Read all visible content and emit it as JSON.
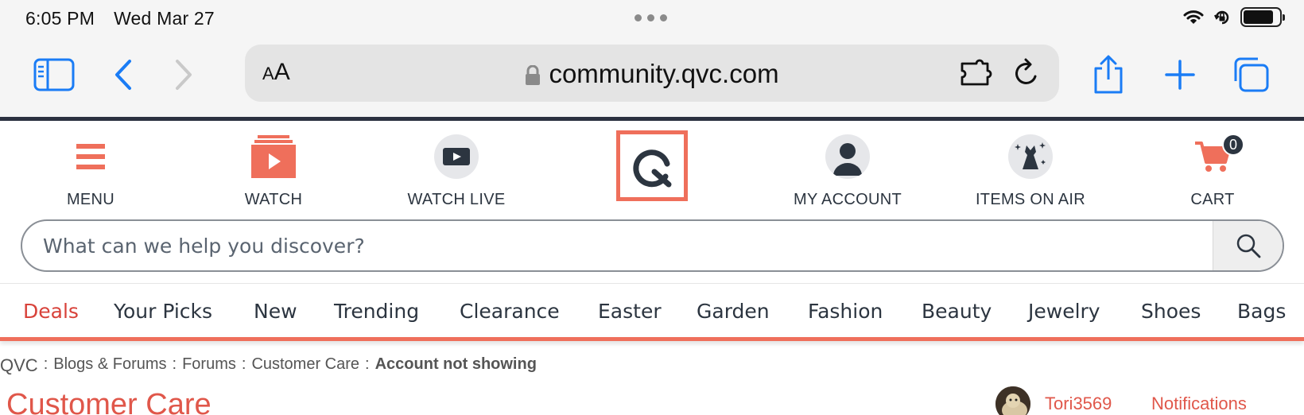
{
  "status_bar": {
    "time": "6:05 PM",
    "date": "Wed Mar 27"
  },
  "browser": {
    "font_size_label_small": "A",
    "font_size_label_large": "A",
    "url": "community.qvc.com"
  },
  "header": {
    "nav": [
      {
        "label": "MENU",
        "icon": "hamburger-icon"
      },
      {
        "label": "WATCH",
        "icon": "play-stack-icon"
      },
      {
        "label": "WATCH LIVE",
        "icon": "live-tv-icon"
      },
      {
        "label": "MY ACCOUNT",
        "icon": "user-icon"
      },
      {
        "label": "ITEMS ON AIR",
        "icon": "dress-sparkle-icon"
      },
      {
        "label": "CART",
        "icon": "cart-icon",
        "badge": "0"
      }
    ],
    "logo_icon": "qvc-logo-icon",
    "accent_color": "#ef6f5b"
  },
  "search": {
    "placeholder": "What can we help you discover?"
  },
  "categories": [
    "Deals",
    "Your Picks",
    "New",
    "Trending",
    "Clearance",
    "Easter",
    "Garden",
    "Fashion",
    "Beauty",
    "Jewelry",
    "Shoes",
    "Bags"
  ],
  "breadcrumb": {
    "root": "QVC",
    "separator": ":",
    "items": [
      "Blogs & Forums",
      "Forums",
      "Customer Care"
    ],
    "current": "Account not showing"
  },
  "page": {
    "title": "Customer Care",
    "username": "Tori3569",
    "notifications_label": "Notifications"
  }
}
